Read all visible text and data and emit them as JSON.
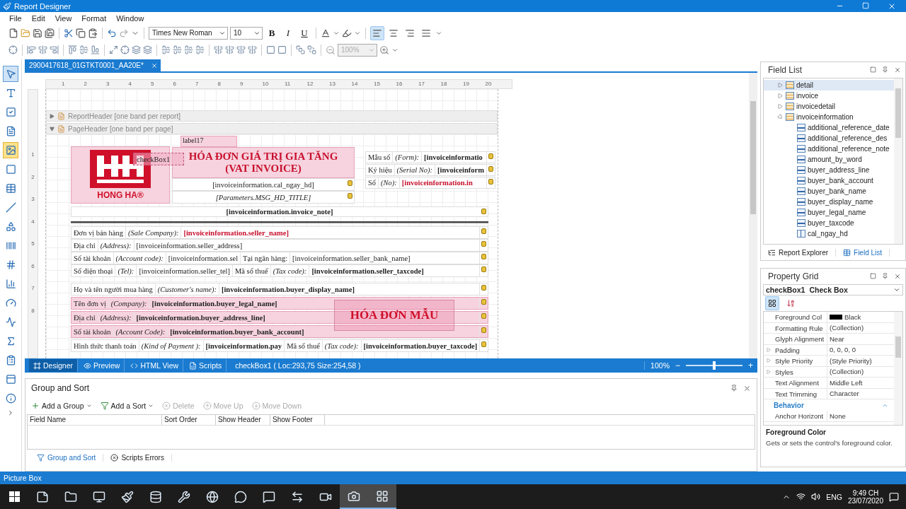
{
  "window": {
    "title": "Report Designer"
  },
  "menu": [
    "File",
    "Edit",
    "View",
    "Format",
    "Window"
  ],
  "toolbar": {
    "font": "Times New Roman",
    "font_size": "10",
    "format_buttons": [
      "B",
      "I",
      "U"
    ],
    "alignment": [
      {
        "selected": true
      },
      {
        "selected": false
      },
      {
        "selected": false
      },
      {
        "selected": false
      }
    ],
    "zoom": {
      "value": "100%",
      "disabled": true
    }
  },
  "toolbox": [
    {
      "kind": "pointer",
      "selected": true,
      "hovered": false
    },
    {
      "kind": "label",
      "selected": false,
      "hovered": false
    },
    {
      "kind": "checkbox",
      "selected": false,
      "hovered": false
    },
    {
      "kind": "richtext",
      "selected": false,
      "hovered": false
    },
    {
      "kind": "picture",
      "selected": false,
      "hovered": true
    },
    {
      "kind": "panel",
      "selected": false,
      "hovered": false
    },
    {
      "kind": "table",
      "selected": false,
      "hovered": false
    },
    {
      "kind": "line",
      "selected": false,
      "hovered": false
    },
    {
      "kind": "shape",
      "selected": false,
      "hovered": false
    },
    {
      "kind": "barcode",
      "selected": false,
      "hovered": false
    },
    {
      "kind": "zipcode",
      "selected": false,
      "hovered": false
    },
    {
      "kind": "chart",
      "selected": false,
      "hovered": false
    },
    {
      "kind": "gauge",
      "selected": false,
      "hovered": false
    },
    {
      "kind": "sparkline",
      "selected": false,
      "hovered": false
    },
    {
      "kind": "summary",
      "selected": false,
      "hovered": false
    },
    {
      "kind": "clipboard",
      "selected": false,
      "hovered": false
    },
    {
      "kind": "subreport",
      "selected": false,
      "hovered": false
    },
    {
      "kind": "pageinfo",
      "selected": false,
      "hovered": false
    }
  ],
  "document_tab": {
    "title": "2900417618_01GTKT0001_AA20E*"
  },
  "ruler": {
    "horizontal": [
      "1",
      "2",
      "3",
      "4",
      "5",
      "6",
      "7",
      "8",
      "9",
      "10",
      "11",
      "12",
      "13",
      "14",
      "15",
      "16",
      "17",
      "18",
      "19",
      "20"
    ],
    "vertical": [
      "1",
      "2",
      "3",
      "4",
      "5",
      "6",
      "7",
      "8"
    ]
  },
  "bands": [
    {
      "label": "ReportHeader [one band per report]",
      "expanded": false
    },
    {
      "label": "PageHeader [one band per page]",
      "expanded": true
    }
  ],
  "report": {
    "label17": "label17",
    "logo_caption": "HONG HA®",
    "checkbox_label": "checkBox1",
    "title": [
      "HÓA ĐƠN GIÁ TRỊ GIA TĂNG",
      "(VAT INVOICE)"
    ],
    "date_field": "[invoiceinformation.cal_ngay_hd]",
    "message_field": "[Parameters.MSG_HD_TITLE]",
    "form_rows": [
      [
        {
          "text": "Mẫu số",
          "kind": "label"
        },
        {
          "text": "(Form):",
          "kind": "hint"
        },
        {
          "text": "[invoiceinformatio",
          "kind": "strong"
        }
      ],
      [
        {
          "text": "Ký hiệu",
          "kind": "label"
        },
        {
          "text": "(Serial No):",
          "kind": "hint"
        },
        {
          "text": "[invoiceinform",
          "kind": "strong"
        }
      ],
      [
        {
          "text": "Số",
          "kind": "label"
        },
        {
          "text": "(No):",
          "kind": "hint"
        },
        {
          "text": "[invoiceinformation.in",
          "kind": "red"
        }
      ]
    ],
    "note": "[invoiceinformation.invoice_note]",
    "seller_rows": [
      {
        "selected": false,
        "cells": [
          {
            "text": "Đơn vị bán hàng",
            "kind": "label"
          },
          {
            "text": "(Sale Company):",
            "kind": "hint"
          },
          {
            "text": "[invoiceinformation.seller_name]",
            "kind": "red"
          }
        ]
      },
      {
        "selected": false,
        "cells": [
          {
            "text": "Địa chỉ",
            "kind": "label"
          },
          {
            "text": "(Address):",
            "kind": "hint"
          },
          {
            "text": "[invoiceinformation.seller_address]",
            "kind": "field"
          }
        ]
      },
      {
        "selected": false,
        "cells": [
          {
            "text": "Số tài khoản",
            "kind": "label"
          },
          {
            "text": "(Account code):",
            "kind": "hint"
          },
          {
            "text": "[invoiceinformation.sel",
            "kind": "field"
          },
          {
            "text": "Tại ngân hàng:",
            "kind": "label"
          },
          {
            "text": "[invoiceinformation.seller_bank_name]",
            "kind": "field"
          }
        ]
      },
      {
        "selected": false,
        "cells": [
          {
            "text": "Số điện thoại",
            "kind": "label"
          },
          {
            "text": "(Tel):",
            "kind": "hint"
          },
          {
            "text": "[invoiceinformation.seller_tel]",
            "kind": "field"
          },
          {
            "text": "Mã số thuế",
            "kind": "label"
          },
          {
            "text": "(Tax code):",
            "kind": "hint"
          },
          {
            "text": "[invoiceinformation.seller_taxcode]",
            "kind": "strong"
          }
        ]
      }
    ],
    "buyer_rows": [
      {
        "selected": false,
        "cells": [
          {
            "text": "Họ và tên người mua hàng",
            "kind": "label"
          },
          {
            "text": "(Customer's name):",
            "kind": "hint"
          },
          {
            "text": "[invoiceinformation.buyer_display_name]",
            "kind": "strong"
          }
        ]
      },
      {
        "selected": true,
        "cells": [
          {
            "text": "Tên đơn vị",
            "kind": "label"
          },
          {
            "text": "(Company):",
            "kind": "hint"
          },
          {
            "text": "[invoiceinformation.buyer_legal_name]",
            "kind": "strong"
          }
        ]
      },
      {
        "selected": true,
        "cells": [
          {
            "text": "Địa chỉ",
            "kind": "label"
          },
          {
            "text": "(Address):",
            "kind": "hint"
          },
          {
            "text": "[invoiceinformation.buyer_address_line]",
            "kind": "strong"
          }
        ]
      },
      {
        "selected": true,
        "cells": [
          {
            "text": "Số tài khoản",
            "kind": "label"
          },
          {
            "text": "(Account Code):",
            "kind": "hint"
          },
          {
            "text": "[invoiceinformation.buyer_bank_account]",
            "kind": "strong"
          }
        ]
      },
      {
        "selected": false,
        "cells": [
          {
            "text": "Hình thức thanh toán",
            "kind": "label"
          },
          {
            "text": "(Kind of Payment ):",
            "kind": "hint"
          },
          {
            "text": "[invoiceinformation.pay",
            "kind": "strong"
          },
          {
            "text": "Mã số thuế",
            "kind": "label"
          },
          {
            "text": "(Tax code):",
            "kind": "hint"
          },
          {
            "text": "[invoiceinformation.buyer_taxcode]",
            "kind": "strong"
          }
        ]
      }
    ],
    "sample_label": "HÓA ĐƠN MẪU"
  },
  "designer_bar": {
    "tabs": [
      {
        "label": "Designer",
        "kind": "designer",
        "selected": true
      },
      {
        "label": "Preview",
        "kind": "preview",
        "selected": false
      },
      {
        "label": "HTML View",
        "kind": "html",
        "selected": false
      },
      {
        "label": "Scripts",
        "kind": "scripts",
        "selected": false
      }
    ],
    "status": "checkBox1 ( Loc:293,75 Size:254,58 )",
    "zoom": "100%",
    "zoom_out": "−",
    "zoom_in": "+",
    "zoom_slider": {
      "level": 0.5
    }
  },
  "group_and_sort": {
    "title": "Group and Sort",
    "actions": [
      {
        "label": "Add a Group",
        "kind": "add-group",
        "disabled": false
      },
      {
        "label": "Add a Sort",
        "kind": "add-sort",
        "disabled": false
      },
      {
        "label": "Delete",
        "kind": "delete",
        "disabled": true
      },
      {
        "label": "Move Up",
        "kind": "up",
        "disabled": true
      },
      {
        "label": "Move Down",
        "kind": "down",
        "disabled": true
      }
    ],
    "columns": [
      "Field Name",
      "Sort Order",
      "Show Header",
      "Show Footer"
    ],
    "tabs": [
      {
        "label": "Group and Sort",
        "kind": "group",
        "selected": true
      },
      {
        "label": "Scripts Errors",
        "kind": "errors",
        "selected": false
      }
    ]
  },
  "field_list": {
    "title": "Field List",
    "tree": [
      {
        "label": "detail",
        "kind": "table",
        "expanded": false,
        "selected": true
      },
      {
        "label": "invoice",
        "kind": "table",
        "expanded": false,
        "selected": false
      },
      {
        "label": "invoicedetail",
        "kind": "table",
        "expanded": false,
        "selected": false
      },
      {
        "label": "invoiceinformation",
        "kind": "table",
        "expanded": true,
        "selected": false,
        "children": [
          {
            "label": "additional_reference_date",
            "kind": "text",
            "selected": false
          },
          {
            "label": "additional_reference_des",
            "kind": "text",
            "selected": false
          },
          {
            "label": "additional_reference_note",
            "kind": "text",
            "selected": false
          },
          {
            "label": "amount_by_word",
            "kind": "text",
            "selected": false
          },
          {
            "label": "buyer_address_line",
            "kind": "text",
            "selected": false
          },
          {
            "label": "buyer_bank_account",
            "kind": "text",
            "selected": false
          },
          {
            "label": "buyer_bank_name",
            "kind": "text",
            "selected": false
          },
          {
            "label": "buyer_display_name",
            "kind": "text",
            "selected": false
          },
          {
            "label": "buyer_legal_name",
            "kind": "text",
            "selected": false
          },
          {
            "label": "buyer_taxcode",
            "kind": "text",
            "selected": false
          },
          {
            "label": "cal_ngay_hd",
            "kind": "calc",
            "selected": false
          }
        ]
      }
    ],
    "tabs": [
      {
        "label": "Report Explorer",
        "kind": "explorer",
        "selected": false
      },
      {
        "label": "Field List",
        "kind": "fields",
        "selected": true
      }
    ]
  },
  "property_grid": {
    "title": "Property Grid",
    "object_name": "checkBox1",
    "object_type": "Check Box",
    "rows": [
      {
        "name": "Foreground Col",
        "value": "Black",
        "kind": "color",
        "color": "#000000"
      },
      {
        "name": "Formatting Rule",
        "value": "(Collection)",
        "kind": "plain"
      },
      {
        "name": "Glyph Alignment",
        "value": "Near",
        "kind": "plain"
      },
      {
        "name": "Padding",
        "value": "0, 0, 0, 0",
        "kind": "expandable"
      },
      {
        "name": "Style Priority",
        "value": "(Style Priority)",
        "kind": "expandable"
      },
      {
        "name": "Styles",
        "value": "(Collection)",
        "kind": "expandable"
      },
      {
        "name": "Text Alignment",
        "value": "Middle Left",
        "kind": "plain"
      },
      {
        "name": "Text Trimming",
        "value": "Character",
        "kind": "plain"
      }
    ],
    "category": {
      "label": "Behavior",
      "expanded": true,
      "rows": [
        {
          "name": "Anchor Horizont",
          "value": "None"
        }
      ]
    },
    "description": {
      "title": "Foreground Color",
      "text": "Gets or sets the control's foreground color."
    }
  },
  "status_bar": "Picture Box",
  "taskbar": {
    "apps": [
      {
        "kind": "sticky",
        "selected": false
      },
      {
        "kind": "folder",
        "selected": false
      },
      {
        "kind": "monitor",
        "selected": false
      },
      {
        "kind": "paint",
        "selected": false
      },
      {
        "kind": "database",
        "selected": false
      },
      {
        "kind": "tools",
        "selected": false
      },
      {
        "kind": "browser",
        "selected": false
      },
      {
        "kind": "chat",
        "selected": false
      },
      {
        "kind": "zalo",
        "selected": false
      },
      {
        "kind": "remote",
        "selected": false
      },
      {
        "kind": "video",
        "selected": false
      },
      {
        "kind": "capture",
        "selected": true
      },
      {
        "kind": "designer",
        "selected": true
      }
    ],
    "language": "ENG",
    "time": "9:49 CH",
    "date": "23/07/2020"
  }
}
